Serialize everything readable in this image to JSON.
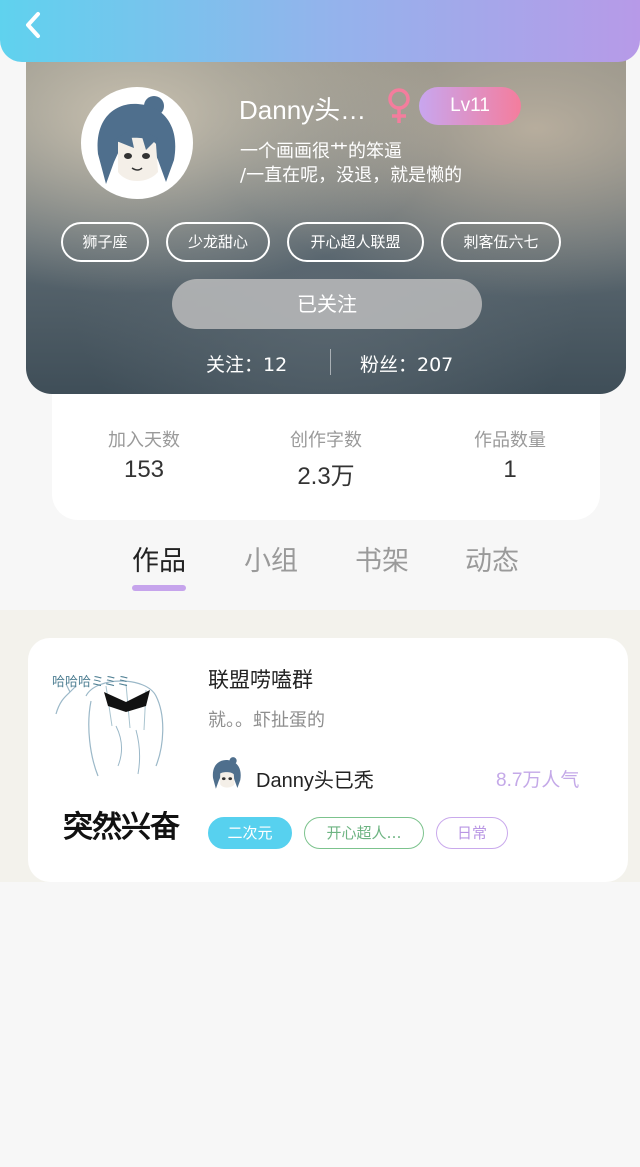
{
  "profile": {
    "username": "Danny头…",
    "level": "Lv11",
    "bio_line1": "一个画画很艹的笨逼",
    "bio_line2": "/一直在呢，没退，就是懒的",
    "tags": [
      "狮子座",
      "少龙甜心",
      "开心超人联盟",
      "刺客伍六七"
    ],
    "follow_button": "已关注",
    "following": "关注：12",
    "fans": "粉丝：207"
  },
  "stats": [
    {
      "label": "加入天数",
      "value": "153"
    },
    {
      "label": "创作字数",
      "value": "2.3万"
    },
    {
      "label": "作品数量",
      "value": "1"
    }
  ],
  "tabs": [
    "作品",
    "小组",
    "书架",
    "动态"
  ],
  "active_tab": "作品",
  "work": {
    "cover_caption": "突然兴奋",
    "title": "联盟唠嗑群",
    "description": "就。。虾扯蛋的",
    "author": "Danny头已秃",
    "popularity": "8.7万人气",
    "tags": [
      "二次元",
      "开心超人…",
      "日常"
    ]
  },
  "colors": {
    "header_gradient_start": "#5fd2ee",
    "header_gradient_end": "#b79ae8",
    "level_badge_start": "#c8a6ef",
    "level_badge_end": "#f47d9d",
    "gender_female": "#f47d9d",
    "tab_indicator": "#c6a4ec",
    "popularity_text": "#c4a9e8",
    "tag_cyan": "#57d1ef",
    "tag_green": "#7cc38d",
    "tag_purple": "#c9a9ec"
  },
  "icons": {
    "back": "chevron-left-icon",
    "gender": "female-icon"
  }
}
